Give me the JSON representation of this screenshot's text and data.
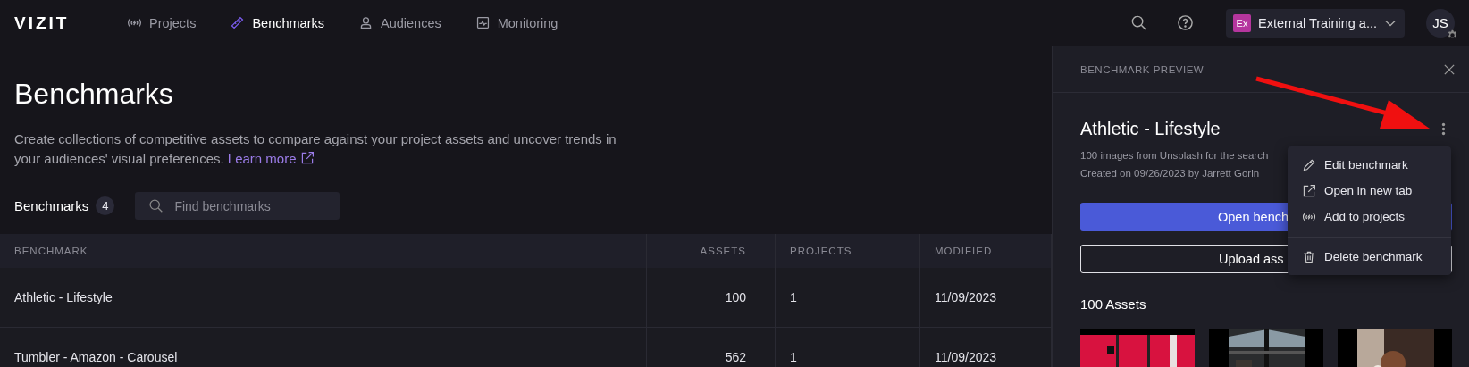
{
  "topbar": {
    "logo": "VIZIT",
    "nav": [
      {
        "label": "Projects",
        "selected": false
      },
      {
        "label": "Benchmarks",
        "selected": true
      },
      {
        "label": "Audiences",
        "selected": false
      },
      {
        "label": "Monitoring",
        "selected": false
      }
    ],
    "workspace": {
      "badge": "Ex",
      "name": "External Training a..."
    },
    "avatar": "JS"
  },
  "page": {
    "title": "Benchmarks",
    "description": "Create collections of competitive assets to compare against your project assets and uncover trends in your audiences' visual preferences.",
    "link": "Learn more",
    "list_title": "Benchmarks",
    "count": "4",
    "search": {
      "placeholder": "Find benchmarks"
    }
  },
  "table": {
    "columns": [
      {
        "label": "BENCHMARK"
      },
      {
        "label": "ASSETS"
      },
      {
        "label": "PROJECTS"
      },
      {
        "label": "MODIFIED"
      }
    ],
    "rows": [
      [
        "Athletic - Lifestyle",
        "100",
        "1",
        "11/09/2023"
      ],
      [
        "Tumbler - Amazon - Carousel",
        "562",
        "1",
        "11/09/2023"
      ]
    ]
  },
  "preview": {
    "heading": "BENCHMARK PREVIEW",
    "title": "Athletic - Lifestyle",
    "description": "100 images from Unsplash for the search",
    "created": "Created on 09/26/2023 by Jarrett Gorin",
    "primary_button": "Open bench",
    "secondary_button": "Upload ass",
    "assets_title": "100 Assets"
  },
  "menu": {
    "groups": [
      [
        {
          "label": "Edit benchmark"
        },
        {
          "label": "Open in new tab"
        },
        {
          "label": "Add to projects"
        }
      ],
      [
        {
          "label": "Delete benchmark"
        }
      ]
    ]
  }
}
